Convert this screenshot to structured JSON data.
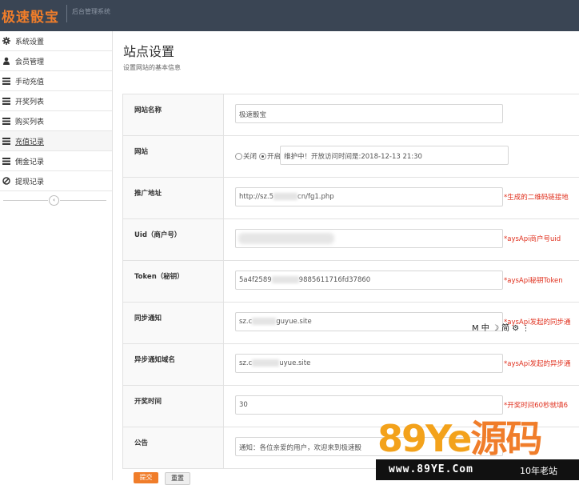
{
  "header": {
    "brand": "极速骰宝",
    "subtitle": "后台管理系统"
  },
  "sidebar": {
    "items": [
      {
        "label": "系统设置",
        "icon": "gear-icon"
      },
      {
        "label": "会员管理",
        "icon": "user-icon"
      },
      {
        "label": "手动充值",
        "icon": "list-icon"
      },
      {
        "label": "开奖列表",
        "icon": "list-icon"
      },
      {
        "label": "购买列表",
        "icon": "list-icon"
      },
      {
        "label": "充值记录",
        "icon": "list-icon",
        "active": true
      },
      {
        "label": "佣金记录",
        "icon": "list-icon"
      },
      {
        "label": "提现记录",
        "icon": "ban-icon"
      }
    ],
    "collapse_glyph": "‹"
  },
  "page": {
    "title": "站点设置",
    "description": "设置网站的基本信息"
  },
  "form": {
    "site_name": {
      "label": "网站名称",
      "value": "极速骰宝"
    },
    "site": {
      "label": "网站",
      "radio_off": "关闭",
      "radio_on": "开启",
      "selected": "开启",
      "maintenance_msg": "维护中！开放访问时间是:2018-12-13 21:30"
    },
    "promo_url": {
      "label": "推广地址",
      "value": "http://sz.5",
      "value_tail": "cn/fg1.php",
      "note": "*生成的二维码链接地"
    },
    "uid": {
      "label": "Uid（商户号）",
      "value": "",
      "note": "*aysApi商户号uid"
    },
    "token": {
      "label": "Token（秘钥）",
      "value": "5a4f2589",
      "value_tail": "9885611716fd37860",
      "note": "*aysApi秘钥Token"
    },
    "sync_notify": {
      "label": "同步通知",
      "value": "sz.c",
      "value_tail": "guyue.site",
      "note": "*aysApi发起的同步通"
    },
    "async_notify": {
      "label": "异步通知域名",
      "value": "sz.c",
      "value_tail": "uyue.site",
      "note": "*aysApi发起的异步通"
    },
    "draw_time": {
      "label": "开奖时间",
      "value": "30",
      "note": "*开奖时间60秒就填6"
    },
    "announcement": {
      "label": "公告",
      "value": "通知：各位亲爱的用户，欢迎来到极速骰"
    }
  },
  "buttons": {
    "save": "提交",
    "reset": "重置"
  },
  "ime_toolbar": "M 中 ☽ 简 ⚙ ⋮",
  "watermark": {
    "big_digits": "89Ye",
    "big_han": "源码",
    "url": "www.89YE.Com",
    "tag": "10年老站"
  }
}
